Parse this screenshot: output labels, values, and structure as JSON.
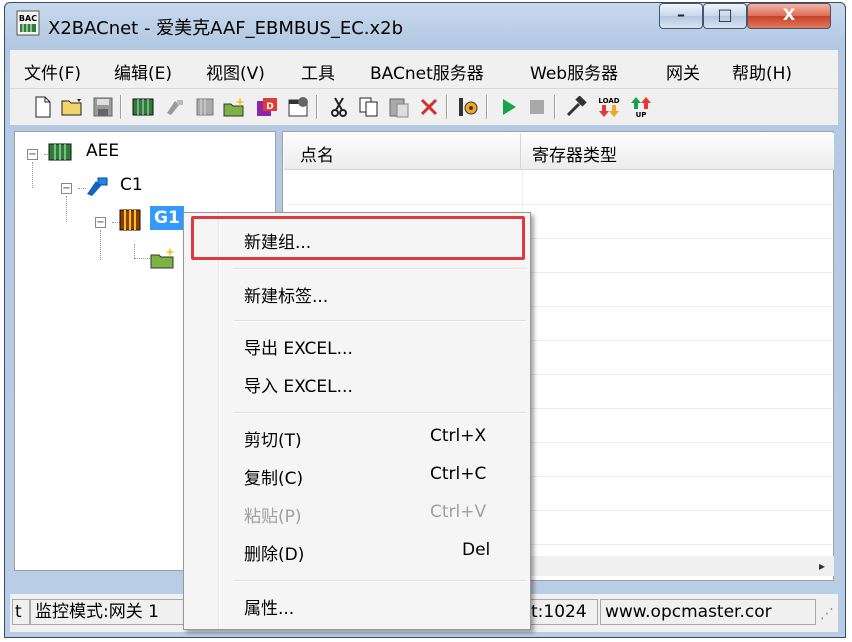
{
  "window": {
    "title": "X2BACnet - 爱美克AAF_EBMBUS_EC.x2b",
    "app_icon_text": "BAC",
    "minimize": "–",
    "maximize": "□",
    "close": "X"
  },
  "menubar": [
    "文件(F)",
    "编辑(E)",
    "视图(V)",
    "工具",
    "BACnet服务器",
    "Web服务器",
    "网关",
    "帮助(H)"
  ],
  "toolbar": {
    "icons": [
      "new-file-icon",
      "open-folder-icon",
      "save-icon",
      "device-icon",
      "channel-icon",
      "group-icon",
      "new-group-icon",
      "tag-icon",
      "properties-icon",
      "cut-icon",
      "copy-icon",
      "paste-icon",
      "delete-icon",
      "tools-icon",
      "run-icon",
      "stop-icon",
      "hammer-icon",
      "load-icon",
      "up-icon"
    ],
    "load_label": "LOAD",
    "up_label": "UP"
  },
  "tree": {
    "root": "AEE",
    "channel": "C1",
    "group": "G1"
  },
  "list": {
    "columns": [
      "点名",
      "寄存器类型"
    ]
  },
  "statusbar": {
    "left_stub": "t",
    "mode": "监控模式:网关 1",
    "port": "t:1024",
    "url": "www.opcmaster.cor"
  },
  "context_menu": {
    "new_group": "新建组...",
    "new_tag": "新建标签...",
    "export_excel": "导出 EXCEL...",
    "import_excel": "导入 EXCEL...",
    "cut": "剪切(T)",
    "cut_key": "Ctrl+X",
    "copy": "复制(C)",
    "copy_key": "Ctrl+C",
    "paste": "粘贴(P)",
    "paste_key": "Ctrl+V",
    "delete": "删除(D)",
    "delete_key": "Del",
    "properties": "属性..."
  },
  "colors": {
    "highlight_border": "#e0383f",
    "selection_bg": "#3399ff"
  }
}
